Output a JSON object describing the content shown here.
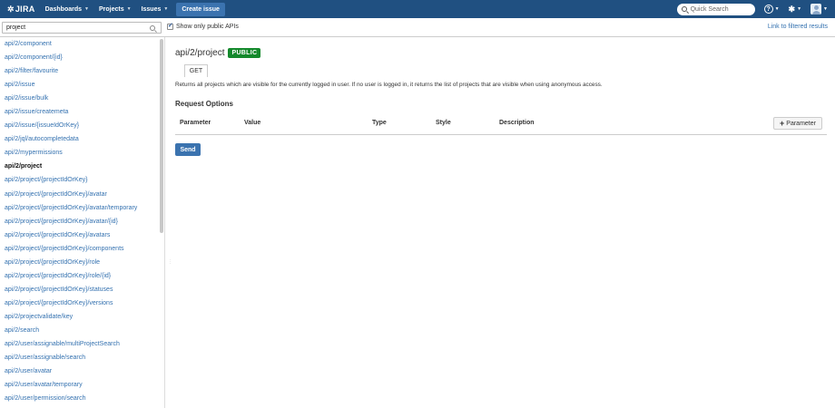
{
  "header": {
    "logo_text": "JIRA",
    "nav": [
      "Dashboards",
      "Projects",
      "Issues"
    ],
    "create_label": "Create issue",
    "search_placeholder": "Quick Search"
  },
  "filter": {
    "value": "project",
    "public_label": "Show only public APIs",
    "link_label": "Link to filtered results"
  },
  "sidebar": {
    "items": [
      "api/2/component",
      "api/2/component/{id}",
      "api/2/filter/favourite",
      "api/2/issue",
      "api/2/issue/bulk",
      "api/2/issue/createmeta",
      "api/2/issue/{issueIdOrKey}",
      "api/2/jql/autocompletedata",
      "api/2/mypermissions",
      "api/2/project",
      "api/2/project/{projectIdOrKey}",
      "api/2/project/{projectIdOrKey}/avatar",
      "api/2/project/{projectIdOrKey}/avatar/temporary",
      "api/2/project/{projectIdOrKey}/avatar/{id}",
      "api/2/project/{projectIdOrKey}/avatars",
      "api/2/project/{projectIdOrKey}/components",
      "api/2/project/{projectIdOrKey}/role",
      "api/2/project/{projectIdOrKey}/role/{id}",
      "api/2/project/{projectIdOrKey}/statuses",
      "api/2/project/{projectIdOrKey}/versions",
      "api/2/projectvalidate/key",
      "api/2/search",
      "api/2/user/assignable/multiProjectSearch",
      "api/2/user/assignable/search",
      "api/2/user/avatar",
      "api/2/user/avatar/temporary",
      "api/2/user/permission/search"
    ],
    "active_index": 9
  },
  "main": {
    "title": "api/2/project",
    "badge": "PUBLIC",
    "method": "GET",
    "description": "Returns all projects which are visible for the currently logged in user. If no user is logged in, it returns the list of projects that are visible when using anonymous access.",
    "request_options_title": "Request Options",
    "columns": [
      "Parameter",
      "Value",
      "Type",
      "Style",
      "Description"
    ],
    "add_param_label": "Parameter",
    "send_label": "Send"
  },
  "colors": {
    "header_bg": "#205081",
    "link": "#3572b0",
    "badge_bg": "#14892c",
    "button_bg": "#3b73af"
  }
}
